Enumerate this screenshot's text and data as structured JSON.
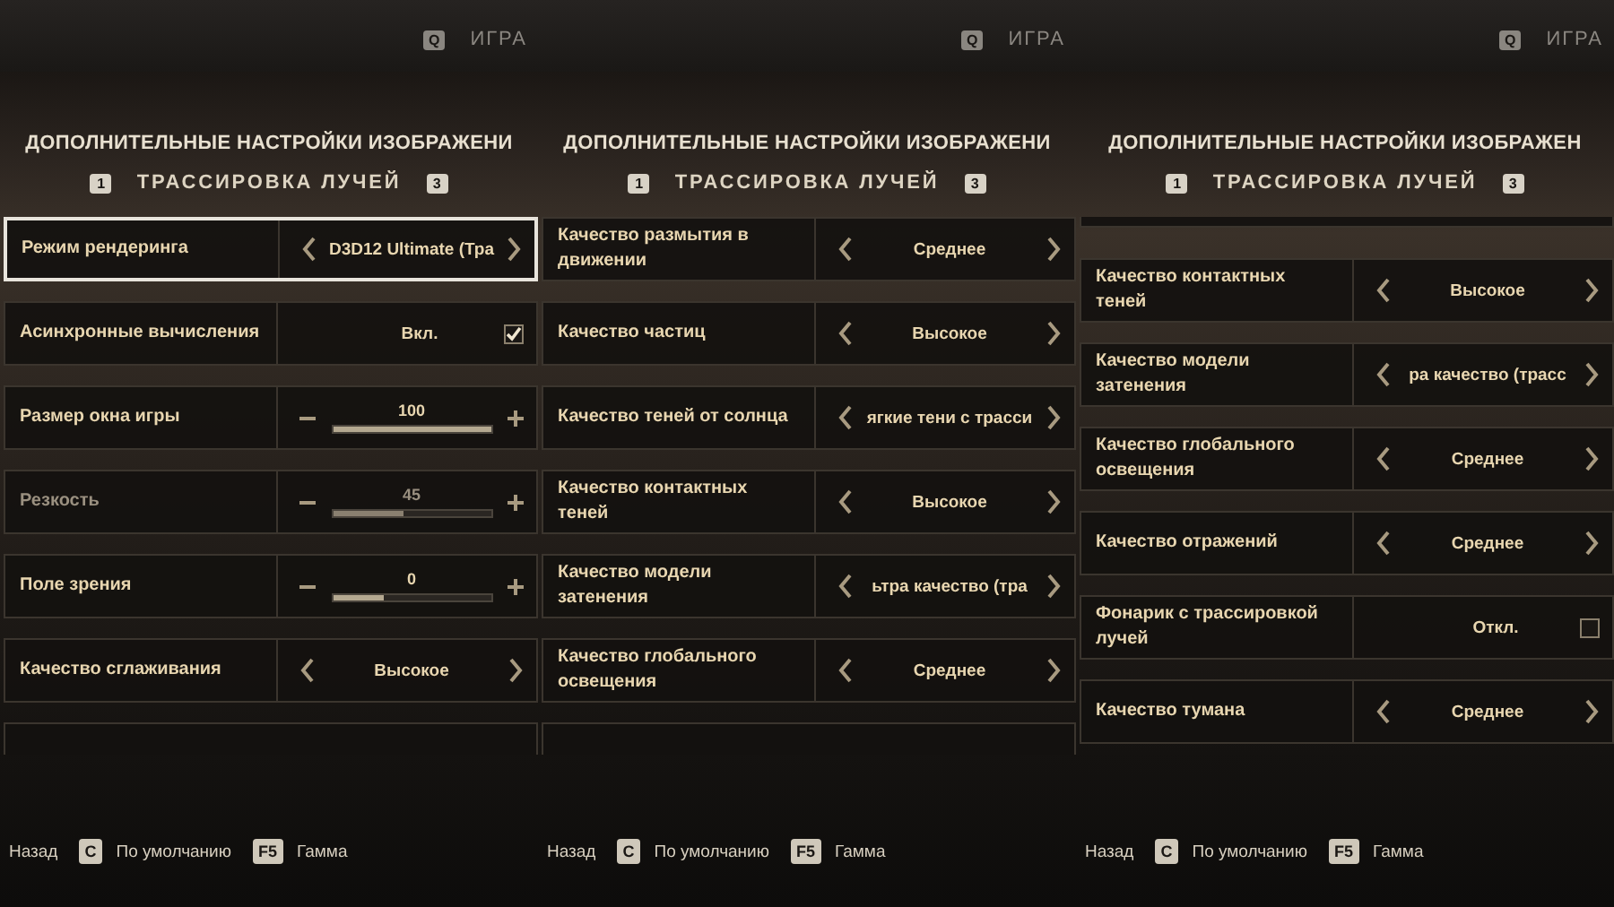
{
  "panels": [
    {
      "top_tab": {
        "key": "Q",
        "label": "ИГРА"
      },
      "title": "ДОПОЛНИТЕЛЬНЫЕ НАСТРОЙКИ ИЗОБРАЖЕНИ",
      "subtitle": {
        "prev_key": "1",
        "label": "ТРАССИРОВКА ЛУЧЕЙ",
        "next_key": "3"
      },
      "cut_above": false,
      "cut_below": true,
      "rows": [
        {
          "kind": "select",
          "label": "Режим рендеринга",
          "value": "D3D12 Ultimate (Тра",
          "selected": true,
          "disabled": false
        },
        {
          "kind": "toggle",
          "label": "Асинхронные вычисления",
          "value": "Вкл.",
          "checked": true,
          "selected": false,
          "disabled": false
        },
        {
          "kind": "slider",
          "label": "Размер окна игры",
          "value": "100",
          "level": 1,
          "selected": false,
          "disabled": false
        },
        {
          "kind": "slider",
          "label": "Резкость",
          "value": "45",
          "level": 0.45,
          "selected": false,
          "disabled": true
        },
        {
          "kind": "slider",
          "label": "Поле зрения",
          "value": "0",
          "level": 0.32,
          "selected": false,
          "disabled": false
        },
        {
          "kind": "select",
          "label": "Качество сглаживания",
          "value": "Высокое",
          "selected": false,
          "disabled": false
        }
      ],
      "footer": [
        {
          "label": "Назад"
        },
        {
          "key": "C",
          "label": "По умолчанию"
        },
        {
          "key": "F5",
          "label": "Гамма"
        }
      ]
    },
    {
      "top_tab": {
        "key": "Q",
        "label": "ИГРА"
      },
      "title": "ДОПОЛНИТЕЛЬНЫЕ НАСТРОЙКИ ИЗОБРАЖЕНИ",
      "subtitle": {
        "prev_key": "1",
        "label": "ТРАССИРОВКА ЛУЧЕЙ",
        "next_key": "3"
      },
      "cut_above": false,
      "cut_below": true,
      "rows": [
        {
          "kind": "select",
          "label": "Качество размытия в движении",
          "value": "Среднее",
          "selected": false,
          "disabled": false
        },
        {
          "kind": "select",
          "label": "Качество частиц",
          "value": "Высокое",
          "selected": false,
          "disabled": false
        },
        {
          "kind": "select",
          "label": "Качество теней от солнца",
          "value": "ягкие тени с трасси",
          "selected": false,
          "disabled": false
        },
        {
          "kind": "select",
          "label": "Качество контактных теней",
          "value": "Высокое",
          "selected": false,
          "disabled": false
        },
        {
          "kind": "select",
          "label": "Качество модели затенения",
          "value": "ьтра качество (тра",
          "selected": false,
          "disabled": false
        },
        {
          "kind": "select",
          "label": "Качество глобального освещения",
          "value": "Среднее",
          "selected": false,
          "disabled": false
        }
      ],
      "footer": [
        {
          "label": "Назад"
        },
        {
          "key": "C",
          "label": "По умолчанию"
        },
        {
          "key": "F5",
          "label": "Гамма"
        }
      ]
    },
    {
      "top_tab": {
        "key": "Q",
        "label": "ИГРА"
      },
      "title": "ДОПОЛНИТЕЛЬНЫЕ НАСТРОЙКИ ИЗОБРАЖЕН",
      "subtitle": {
        "prev_key": "1",
        "label": "ТРАССИРОВКА ЛУЧЕЙ",
        "next_key": "3"
      },
      "cut_above": true,
      "cut_below": false,
      "rows": [
        {
          "kind": "select",
          "label": "Качество контактных теней",
          "value": "Высокое",
          "selected": false,
          "disabled": false
        },
        {
          "kind": "select",
          "label": "Качество модели затенения",
          "value": "ра качество (трасс",
          "selected": false,
          "disabled": false
        },
        {
          "kind": "select",
          "label": "Качество глобального освещения",
          "value": "Среднее",
          "selected": false,
          "disabled": false
        },
        {
          "kind": "select",
          "label": "Качество отражений",
          "value": "Среднее",
          "selected": false,
          "disabled": false
        },
        {
          "kind": "toggle",
          "label": "Фонарик с трассировкой лучей",
          "value": "Откл.",
          "checked": false,
          "selected": false,
          "disabled": false
        },
        {
          "kind": "select",
          "label": "Качество тумана",
          "value": "Среднее",
          "selected": false,
          "disabled": false
        }
      ],
      "footer": [
        {
          "label": "Назад"
        },
        {
          "key": "C",
          "label": "По умолчанию"
        },
        {
          "key": "F5",
          "label": "Гамма"
        }
      ]
    }
  ]
}
